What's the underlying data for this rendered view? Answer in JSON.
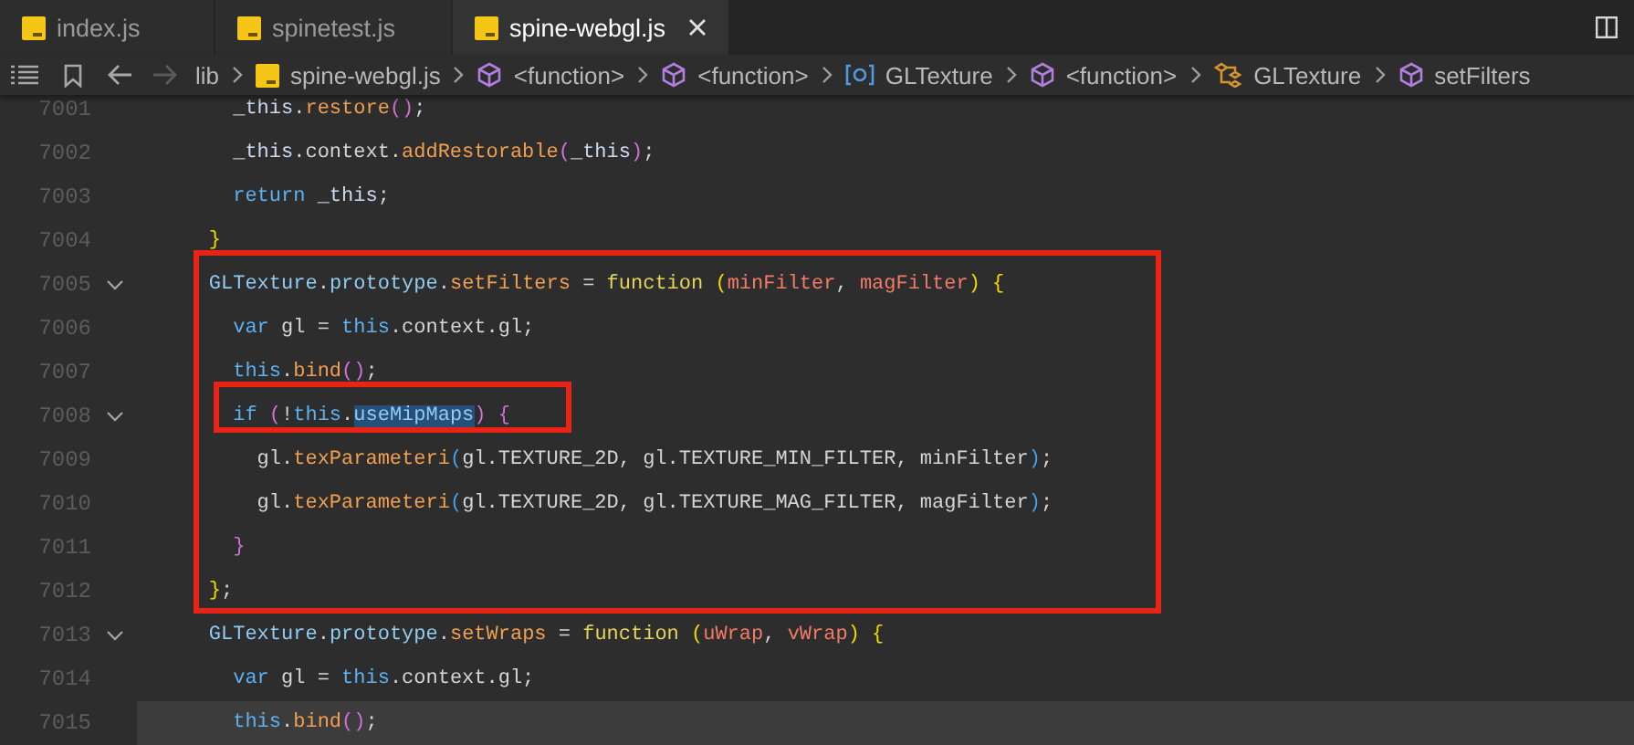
{
  "tabs": [
    {
      "label": "index.js",
      "selected": false
    },
    {
      "label": "spinetest.js",
      "selected": false
    },
    {
      "label": "spine-webgl.js",
      "selected": true
    }
  ],
  "nav": [
    {
      "kind": "back",
      "disabled": false
    },
    {
      "kind": "forward",
      "disabled": true
    }
  ],
  "breadcrumbs": [
    {
      "kind": "folder",
      "label": "lib"
    },
    {
      "kind": "file",
      "label": "spine-webgl.js"
    },
    {
      "kind": "function",
      "label": "<function>"
    },
    {
      "kind": "function",
      "label": "<function>"
    },
    {
      "kind": "variable",
      "label": "GLTexture"
    },
    {
      "kind": "function",
      "label": "<function>"
    },
    {
      "kind": "class",
      "label": "GLTexture"
    },
    {
      "kind": "function",
      "label": "setFilters"
    }
  ],
  "lines": [
    {
      "number": "7001",
      "foldable": false,
      "current": false,
      "tokens": [
        {
          "kind": "var",
          "text": "      _this."
        },
        {
          "kind": "method",
          "text": "restore"
        },
        {
          "kind": "b2",
          "text": "()"
        },
        {
          "kind": "plain",
          "text": ";"
        }
      ]
    },
    {
      "number": "7002",
      "foldable": false,
      "current": false,
      "tokens": [
        {
          "kind": "var",
          "text": "      _this."
        },
        {
          "kind": "plain",
          "text": "context."
        },
        {
          "kind": "method",
          "text": "addRestorable"
        },
        {
          "kind": "b2",
          "text": "("
        },
        {
          "kind": "var",
          "text": "_this"
        },
        {
          "kind": "b2",
          "text": ")"
        },
        {
          "kind": "plain",
          "text": ";"
        }
      ]
    },
    {
      "number": "7003",
      "foldable": false,
      "current": false,
      "tokens": [
        {
          "kind": "keyword",
          "text": "      return"
        },
        {
          "kind": "var",
          "text": " _this"
        },
        {
          "kind": "plain",
          "text": ";"
        }
      ]
    },
    {
      "number": "7004",
      "foldable": false,
      "current": false,
      "tokens": [
        {
          "kind": "b1",
          "text": "    }"
        }
      ]
    },
    {
      "number": "7005",
      "foldable": true,
      "current": false,
      "tokens": [
        {
          "kind": "class",
          "text": "    GLTexture"
        },
        {
          "kind": "plain",
          "text": "."
        },
        {
          "kind": "class",
          "text": "prototype"
        },
        {
          "kind": "plain",
          "text": "."
        },
        {
          "kind": "method",
          "text": "setFilters"
        },
        {
          "kind": "plain",
          "text": " = "
        },
        {
          "kind": "func",
          "text": "function"
        },
        {
          "kind": "b1",
          "text": " ("
        },
        {
          "kind": "param",
          "text": "minFilter"
        },
        {
          "kind": "plain",
          "text": ", "
        },
        {
          "kind": "param",
          "text": "magFilter"
        },
        {
          "kind": "b1",
          "text": ") {"
        }
      ]
    },
    {
      "number": "7006",
      "foldable": false,
      "current": false,
      "tokens": [
        {
          "kind": "keyword",
          "text": "      var"
        },
        {
          "kind": "plain",
          "text": " gl = "
        },
        {
          "kind": "keyword",
          "text": "this"
        },
        {
          "kind": "plain",
          "text": ".context.gl;"
        }
      ]
    },
    {
      "number": "7007",
      "foldable": false,
      "current": false,
      "tokens": [
        {
          "kind": "keyword",
          "text": "      this"
        },
        {
          "kind": "plain",
          "text": "."
        },
        {
          "kind": "method",
          "text": "bind"
        },
        {
          "kind": "b2",
          "text": "()"
        },
        {
          "kind": "plain",
          "text": ";"
        }
      ]
    },
    {
      "number": "7008",
      "foldable": true,
      "current": false,
      "tokens": [
        {
          "kind": "keyword",
          "text": "      if"
        },
        {
          "kind": "b2",
          "text": " ("
        },
        {
          "kind": "plain",
          "text": "!"
        },
        {
          "kind": "keyword",
          "text": "this"
        },
        {
          "kind": "plain",
          "text": "."
        },
        {
          "kind": "highlight",
          "text": "useMipMaps"
        },
        {
          "kind": "b2",
          "text": ") {"
        }
      ]
    },
    {
      "number": "7009",
      "foldable": false,
      "current": false,
      "tokens": [
        {
          "kind": "plain",
          "text": "        gl."
        },
        {
          "kind": "method",
          "text": "texParameteri"
        },
        {
          "kind": "b3",
          "text": "("
        },
        {
          "kind": "plain",
          "text": "gl.TEXTURE_2D, gl.TEXTURE_MIN_FILTER, minFilter"
        },
        {
          "kind": "b3",
          "text": ")"
        },
        {
          "kind": "plain",
          "text": ";"
        }
      ]
    },
    {
      "number": "7010",
      "foldable": false,
      "current": false,
      "tokens": [
        {
          "kind": "plain",
          "text": "        gl."
        },
        {
          "kind": "method",
          "text": "texParameteri"
        },
        {
          "kind": "b3",
          "text": "("
        },
        {
          "kind": "plain",
          "text": "gl.TEXTURE_2D, gl.TEXTURE_MAG_FILTER, magFilter"
        },
        {
          "kind": "b3",
          "text": ")"
        },
        {
          "kind": "plain",
          "text": ";"
        }
      ]
    },
    {
      "number": "7011",
      "foldable": false,
      "current": false,
      "tokens": [
        {
          "kind": "b2",
          "text": "      }"
        }
      ]
    },
    {
      "number": "7012",
      "foldable": false,
      "current": false,
      "tokens": [
        {
          "kind": "b1",
          "text": "    }"
        },
        {
          "kind": "plain",
          "text": ";"
        }
      ]
    },
    {
      "number": "7013",
      "foldable": true,
      "current": false,
      "tokens": [
        {
          "kind": "class",
          "text": "    GLTexture"
        },
        {
          "kind": "plain",
          "text": "."
        },
        {
          "kind": "class",
          "text": "prototype"
        },
        {
          "kind": "plain",
          "text": "."
        },
        {
          "kind": "method",
          "text": "setWraps"
        },
        {
          "kind": "plain",
          "text": " = "
        },
        {
          "kind": "func",
          "text": "function"
        },
        {
          "kind": "b1",
          "text": " ("
        },
        {
          "kind": "param",
          "text": "uWrap"
        },
        {
          "kind": "plain",
          "text": ", "
        },
        {
          "kind": "param",
          "text": "vWrap"
        },
        {
          "kind": "b1",
          "text": ") {"
        }
      ]
    },
    {
      "number": "7014",
      "foldable": false,
      "current": false,
      "tokens": [
        {
          "kind": "keyword",
          "text": "      var"
        },
        {
          "kind": "plain",
          "text": " gl = "
        },
        {
          "kind": "keyword",
          "text": "this"
        },
        {
          "kind": "plain",
          "text": ".context.gl;"
        }
      ]
    },
    {
      "number": "7015",
      "foldable": false,
      "current": true,
      "tokens": [
        {
          "kind": "keyword",
          "text": "      this"
        },
        {
          "kind": "plain",
          "text": "."
        },
        {
          "kind": "method",
          "text": "bind"
        },
        {
          "kind": "b2",
          "text": "()"
        },
        {
          "kind": "plain",
          "text": ";"
        }
      ]
    }
  ]
}
